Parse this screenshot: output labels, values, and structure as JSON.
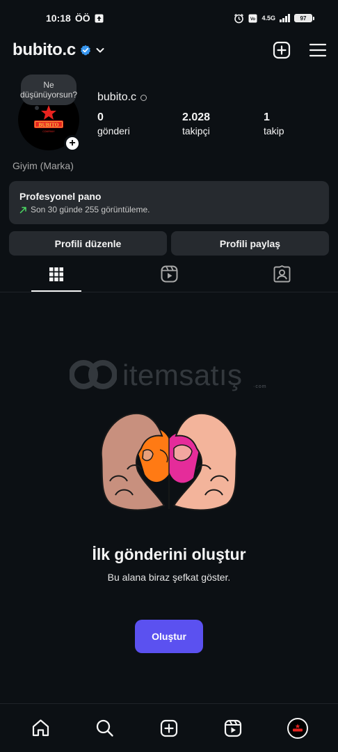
{
  "status_bar": {
    "time": "10:18",
    "carrier_label": "ÖÖ",
    "network": "4.5G",
    "battery": "97"
  },
  "header": {
    "username": "bubito.c"
  },
  "profile": {
    "note_text": "Ne düşünüyorsun?",
    "name": "bubito.c",
    "category": "Giyim (Marka)",
    "logo_text": "BUBITO",
    "logo_subtext": "COMPANY",
    "stats": [
      {
        "value": "0",
        "label": "gönderi"
      },
      {
        "value": "2.028",
        "label": "takipçi"
      },
      {
        "value": "1",
        "label": "takip"
      }
    ]
  },
  "professional_dashboard": {
    "title": "Profesyonel pano",
    "subtitle": "Son 30 günde 255 görüntüleme."
  },
  "actions": {
    "edit_profile": "Profili düzenle",
    "share_profile": "Profili paylaş"
  },
  "watermark": {
    "text": "itemsatış",
    "subtext": "·com"
  },
  "empty_state": {
    "title": "İlk gönderini oluştur",
    "subtitle": "Bu alana biraz şefkat göster.",
    "button": "Oluştur"
  },
  "colors": {
    "background": "#0c1014",
    "card": "#262a2f",
    "accent": "#5b51f0",
    "verified": "#3897f0",
    "trend": "#4cd964"
  }
}
